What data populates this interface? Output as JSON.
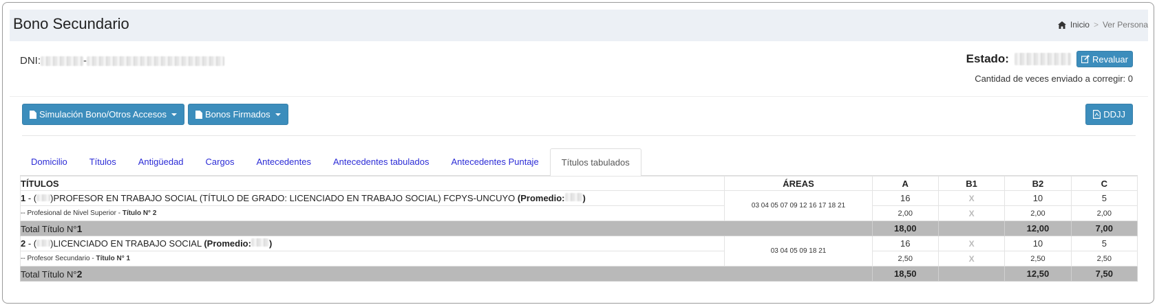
{
  "header": {
    "title": "Bono Secundario",
    "breadcrumb": {
      "home": "Inicio",
      "separator": ">",
      "current": "Ver Persona"
    }
  },
  "persona": {
    "dni_label": "DNI:",
    "dni_separator": "-",
    "estado_label": "Estado:",
    "revaluar_label": "Revaluar",
    "corregir_text": "Cantidad de veces enviado a corregir: 0"
  },
  "actions": {
    "simulacion_label": "Simulación Bono/Otros Accesos",
    "bonos_firmados_label": "Bonos Firmados",
    "ddjj_label": "DDJJ"
  },
  "tabs": [
    {
      "label": "Domicilio",
      "active": false
    },
    {
      "label": "Títulos",
      "active": false
    },
    {
      "label": "Antigüedad",
      "active": false
    },
    {
      "label": "Cargos",
      "active": false
    },
    {
      "label": "Antecedentes",
      "active": false
    },
    {
      "label": "Antecedentes tabulados",
      "active": false
    },
    {
      "label": "Antecedentes Puntaje",
      "active": false
    },
    {
      "label": "Títulos tabulados",
      "active": true
    }
  ],
  "table": {
    "headers": {
      "titulos": "TÍTULOS",
      "areas": "ÁREAS",
      "a": "A",
      "b1": "B1",
      "b2": "B2",
      "c": "C"
    },
    "rows": [
      {
        "number": "1",
        "dash": " - (",
        "name": ")PROFESOR EN TRABAJO SOCIAL (TÍTULO DE GRADO: LICENCIADO EN TRABAJO SOCIAL) FCPYS-UNCUYO ",
        "promedio_label": "(Promedio:",
        "close": ")",
        "subtitle_prefix": "-- Profesional de Nivel Superior - ",
        "subtitle_bold": "Título N° 2",
        "areas": "03 04 05 07 09 12 16 17 18 21",
        "a": "16",
        "b1": "X",
        "b2": "10",
        "c": "5",
        "a2": "2,00",
        "b1_2": "X",
        "b2_2": "2,00",
        "c2": "2,00",
        "total_label": "Total Título N°",
        "total_number": "1",
        "total_a": "18,00",
        "total_b1": "",
        "total_b2": "12,00",
        "total_c": "7,00"
      },
      {
        "number": "2",
        "dash": " - (",
        "name": ")LICENCIADO EN TRABAJO SOCIAL ",
        "promedio_label": "(Promedio:",
        "close": ")",
        "subtitle_prefix": "-- Profesor Secundario - ",
        "subtitle_bold": "Título N° 1",
        "areas": "03 04 05 09 18 21",
        "a": "16",
        "b1": "X",
        "b2": "10",
        "c": "5",
        "a2": "2,50",
        "b1_2": "X",
        "b2_2": "2,50",
        "c2": "2,50",
        "total_label": "Total Título N°",
        "total_number": "2",
        "total_a": "18,50",
        "total_b1": "",
        "total_b2": "12,50",
        "total_c": "7,50"
      }
    ]
  }
}
